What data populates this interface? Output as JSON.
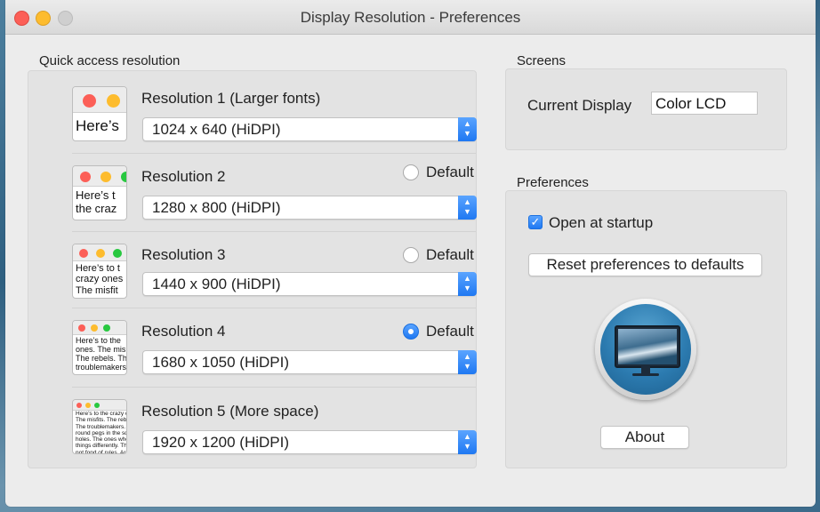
{
  "window": {
    "title": "Display Resolution - Preferences"
  },
  "quick_access": {
    "label": "Quick access resolution",
    "default_label": "Default",
    "rows": [
      {
        "title": "Resolution 1 (Larger fonts)",
        "value": "1024 x 640 (HiDPI)",
        "preview_text": "Here’s",
        "has_default": false,
        "is_default": false
      },
      {
        "title": "Resolution 2",
        "value": "1280 x 800 (HiDPI)",
        "preview_text": "Here’s t\nthe craz",
        "has_default": true,
        "is_default": false
      },
      {
        "title": "Resolution 3",
        "value": "1440 x 900 (HiDPI)",
        "preview_text": "Here’s to t\ncrazy ones\nThe misfit",
        "has_default": true,
        "is_default": false
      },
      {
        "title": "Resolution 4",
        "value": "1680 x 1050 (HiDPI)",
        "preview_text": "Here’s to the\nones. The mis\nThe rebels. Th\ntroublemakers",
        "has_default": true,
        "is_default": true
      },
      {
        "title": "Resolution 5 (More space)",
        "value": "1920 x 1200 (HiDPI)",
        "preview_text": "Here’s to the crazy o\nThe misfits. The rebe\nThe troublemakers.\nround pegs in the sq\nholes. The ones who\nthings differently. Th\nnot fond of rules. Ar",
        "has_default": false,
        "is_default": false
      }
    ]
  },
  "screens": {
    "label": "Screens",
    "current_display_label": "Current Display",
    "current_display_value": "Color LCD"
  },
  "preferences": {
    "label": "Preferences",
    "open_at_startup_label": "Open at startup",
    "open_at_startup_checked": true,
    "reset_label": "Reset preferences to defaults",
    "about_label": "About",
    "app_icon": "monitor-app-icon"
  },
  "colors": {
    "accent": "#1f78f2",
    "panel": "#e3e3e3",
    "window": "#ececec"
  }
}
